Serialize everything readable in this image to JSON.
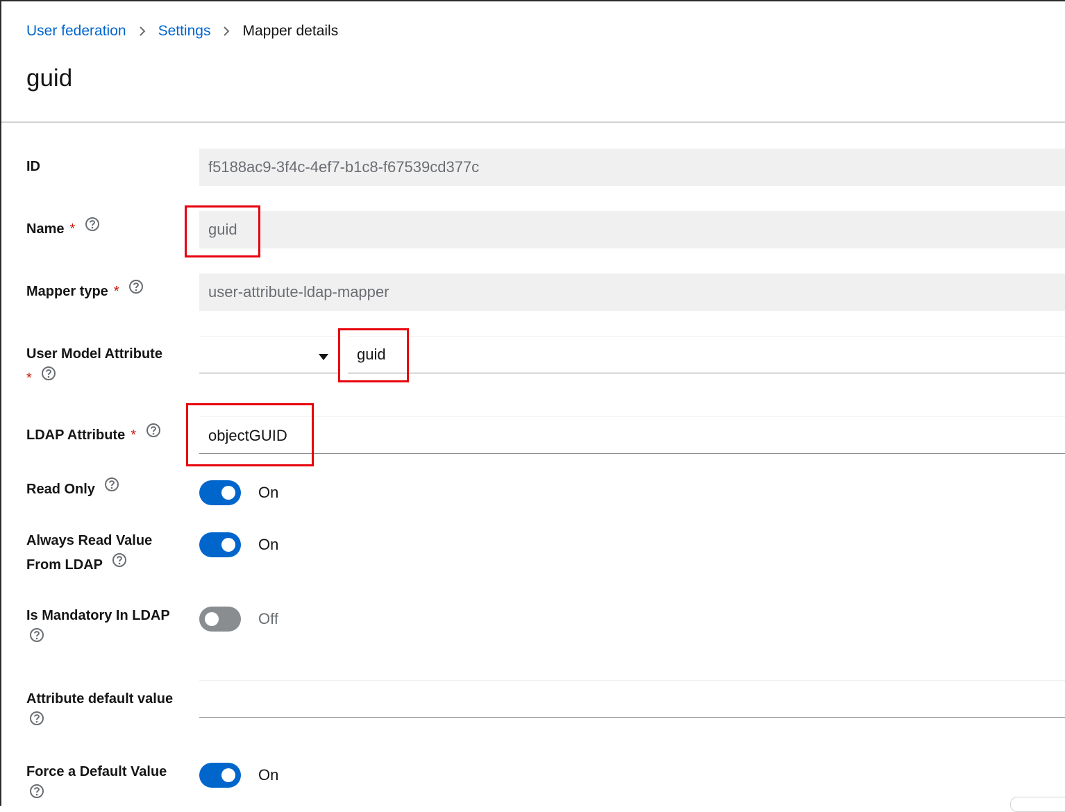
{
  "breadcrumb": {
    "items": [
      {
        "label": "User federation"
      },
      {
        "label": "Settings"
      }
    ],
    "current": "Mapper details"
  },
  "page": {
    "title": "guid"
  },
  "form": {
    "id": {
      "label": "ID",
      "value": "f5188ac9-3f4c-4ef7-b1c8-f67539cd377c"
    },
    "name": {
      "label": "Name",
      "required_mark": "*",
      "value": "guid"
    },
    "mapper_type": {
      "label": "Mapper type",
      "required_mark": "*",
      "value": "user-attribute-ldap-mapper"
    },
    "user_model_attribute": {
      "label": "User Model Attribute",
      "required_mark": "*",
      "select_value": "",
      "typeahead_value": "guid"
    },
    "ldap_attribute": {
      "label": "LDAP Attribute",
      "required_mark": "*",
      "value": "objectGUID"
    },
    "read_only": {
      "label": "Read Only",
      "checked": true,
      "state_label": "On"
    },
    "always_read_value": {
      "label_line1": "Always Read Value",
      "label_line2": "From LDAP",
      "checked": true,
      "state_label": "On"
    },
    "is_mandatory": {
      "label": "Is Mandatory In LDAP",
      "checked": false,
      "state_label": "Off"
    },
    "attribute_default_value": {
      "label": "Attribute default value",
      "value": ""
    },
    "force_default_value": {
      "label": "Force a Default Value",
      "checked": true,
      "state_label": "On"
    }
  },
  "icons": {
    "help": "help-circle-icon",
    "breadcrumb_separator": "angle-right-icon",
    "select_caret": "caret-down-icon"
  },
  "colors": {
    "link": "#0066cc",
    "required": "#c9190b",
    "switch_on": "#0066cc",
    "switch_off": "#8a8d90",
    "highlight": "#e8000b",
    "readonly_bg": "#f0f0f0"
  }
}
